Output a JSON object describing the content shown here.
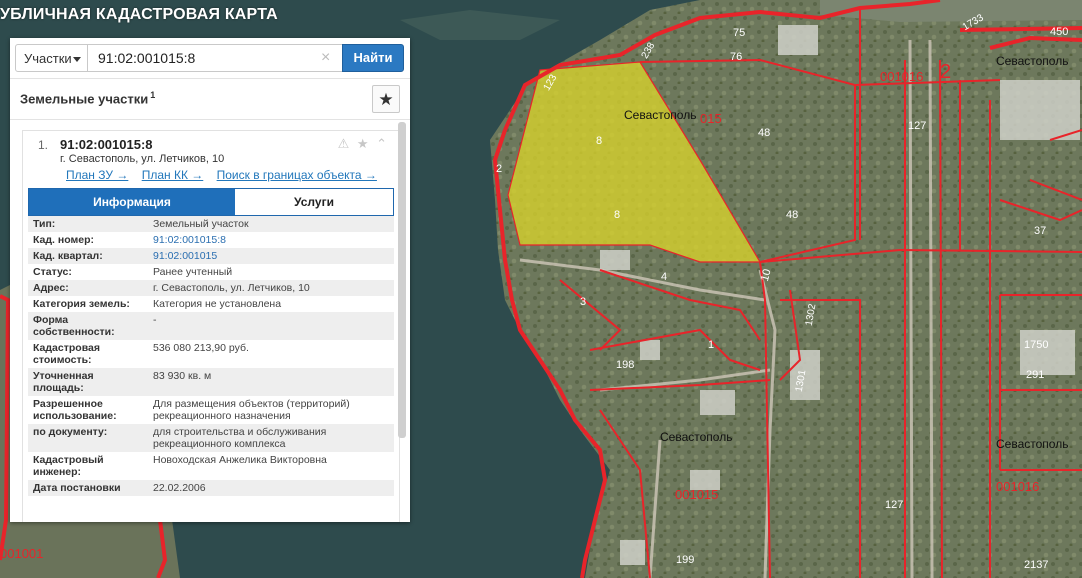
{
  "app": {
    "title": "УБЛИЧНАЯ КАДАСТРОВАЯ КАРТА"
  },
  "search": {
    "type_label": "Участки",
    "value": "91:02:001015:8",
    "clear_symbol": "×",
    "button_label": "Найти"
  },
  "section": {
    "title": "Земельные участки",
    "count": "1",
    "favorite_symbol": "★"
  },
  "result": {
    "index": "1.",
    "cad_number": "91:02:001015:8",
    "address": "г. Севастополь, ул. Летчиков, 10",
    "icons": "⚠ ★ ⌃",
    "links": [
      "План ЗУ →",
      "План КК →",
      "Поиск в границах объекта →"
    ],
    "tabs": [
      "Информация",
      "Услуги"
    ],
    "properties": [
      {
        "label": "Тип:",
        "value": "Земельный участок"
      },
      {
        "label": "Кад. номер:",
        "value": "91:02:001015:8"
      },
      {
        "label": "Кад. квартал:",
        "value": "91:02:001015"
      },
      {
        "label": "Статус:",
        "value": "Ранее учтенный"
      },
      {
        "label": "Адрес:",
        "value": "г. Севастополь, ул. Летчиков, 10"
      },
      {
        "label": "Категория земель:",
        "value": "Категория не установлена"
      },
      {
        "label": "Форма собственности:",
        "value": "-"
      },
      {
        "label": "Кадастровая стоимость:",
        "value": "536 080 213,90 руб."
      },
      {
        "label": "Уточненная площадь:",
        "value": "83 930 кв. м"
      },
      {
        "label": "Разрешенное использование:",
        "value": "Для размещения объектов (территорий) рекреационного назначения"
      },
      {
        "label": "по документу:",
        "value": "для строительства и обслуживания рекреационного комплекса"
      },
      {
        "label": "Кадастровый инженер:",
        "value": "Новоходская Анжелика Викторовна"
      },
      {
        "label": "Дата постановки",
        "value": "22.02.2006"
      }
    ]
  },
  "map": {
    "labels": {
      "sev1": "Севастополь",
      "sev2": "Севастополь",
      "sev3": "Севастополь",
      "sev4": "Севастополь",
      "q1015a": "015",
      "q1015b": "001015",
      "q1016a": "001016",
      "q1016b": "001016",
      "q1001": "001001",
      "n2": "2",
      "n3": "3",
      "n4": "4",
      "n1": "1",
      "n8a": "8",
      "n8b": "8",
      "n10": "10",
      "n37": "37",
      "n48a": "48",
      "n48b": "48",
      "n75": "75",
      "n76": "76",
      "n123": "123",
      "n127a": "127",
      "n127b": "127",
      "n198": "198",
      "n199": "199",
      "n238": "238",
      "n291": "291",
      "n450": "450",
      "n1301": "1301",
      "n1302": "1302",
      "n1733": "1733",
      "n1750": "1750",
      "n2137": "2137",
      "bigtwo": "2"
    },
    "colors": {
      "sea": "#2d4a4c",
      "land": "#6f7a5e",
      "boundary": "#e8242a",
      "parcel_fill": "#d8d42c"
    }
  }
}
